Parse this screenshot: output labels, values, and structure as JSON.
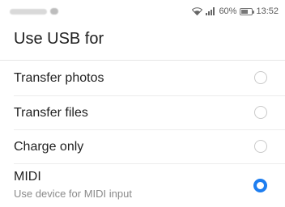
{
  "status": {
    "battery_percent": "60%",
    "battery_level": 0.6,
    "time": "13:52"
  },
  "title": "Use USB for",
  "options": [
    {
      "label": "Transfer photos",
      "selected": false
    },
    {
      "label": "Transfer files",
      "selected": false
    },
    {
      "label": "Charge only",
      "selected": false
    },
    {
      "label": "MIDI",
      "sublabel": "Use device for MIDI input",
      "selected": true
    }
  ],
  "colors": {
    "accent": "#1e7ef0",
    "radio_border": "#c9c9c9"
  }
}
